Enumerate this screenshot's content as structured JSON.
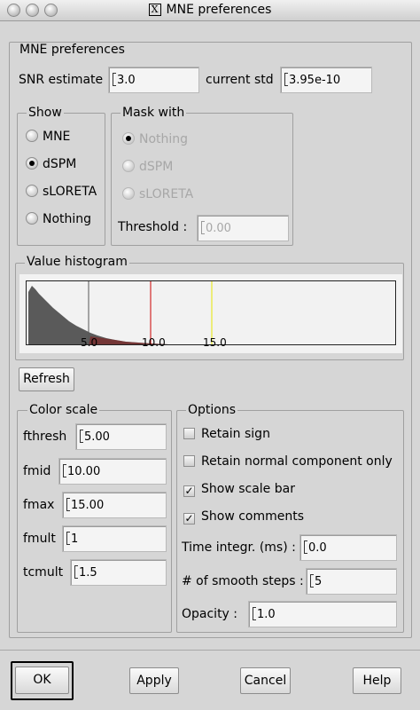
{
  "window": {
    "title": "MNE preferences",
    "title_glyph": "X"
  },
  "main_group": {
    "legend": "MNE preferences"
  },
  "snr": {
    "label": "SNR estimate",
    "value": "3.0"
  },
  "current_std": {
    "label": "current std",
    "value": "3.95e-10"
  },
  "show": {
    "legend": "Show",
    "options": [
      {
        "label": "MNE",
        "selected": false
      },
      {
        "label": "dSPM",
        "selected": true
      },
      {
        "label": "sLORETA",
        "selected": false
      },
      {
        "label": "Nothing",
        "selected": false
      }
    ]
  },
  "mask_with": {
    "legend": "Mask with",
    "options": [
      {
        "label": "Nothing",
        "selected": true
      },
      {
        "label": "dSPM",
        "selected": false
      },
      {
        "label": "sLORETA",
        "selected": false
      }
    ],
    "threshold_label": "Threshold :",
    "threshold_value": "0.00",
    "enabled": false
  },
  "histogram": {
    "legend": "Value histogram",
    "tick_labels": [
      "5.0",
      "10.0",
      "15.0"
    ],
    "markers": [
      {
        "value": 5.0,
        "color": "#555555"
      },
      {
        "value": 10.0,
        "color": "#cc0000"
      },
      {
        "value": 15.0,
        "color": "#e6e600"
      }
    ]
  },
  "refresh_label": "Refresh",
  "color_scale": {
    "legend": "Color scale",
    "fields": [
      {
        "label": "fthresh",
        "value": "5.00"
      },
      {
        "label": "fmid",
        "value": "10.00"
      },
      {
        "label": "fmax",
        "value": "15.00"
      },
      {
        "label": "fmult",
        "value": "1"
      },
      {
        "label": "tcmult",
        "value": "1.5"
      }
    ]
  },
  "options": {
    "legend": "Options",
    "checks": [
      {
        "label": "Retain sign",
        "checked": false
      },
      {
        "label": "Retain normal component only",
        "checked": false
      },
      {
        "label": "Show scale bar",
        "checked": true
      },
      {
        "label": "Show comments",
        "checked": true
      }
    ],
    "time_integr": {
      "label": "Time integr. (ms) :",
      "value": "0.0"
    },
    "smooth_steps": {
      "label": "# of smooth steps :",
      "value": "5"
    },
    "opacity": {
      "label": "Opacity :",
      "value": "1.0"
    }
  },
  "buttons": {
    "ok": "OK",
    "apply": "Apply",
    "cancel": "Cancel",
    "help": "Help"
  },
  "colors": {
    "histogram_fill": "#5a5a5a",
    "histogram_red": "#8b1a1a"
  }
}
